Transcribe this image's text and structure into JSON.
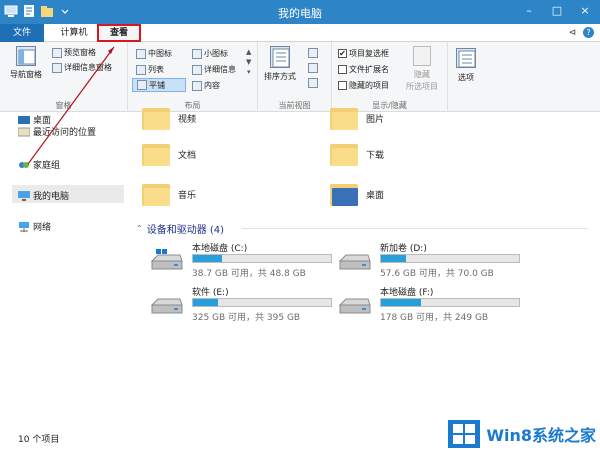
{
  "window": {
    "title": "我的电脑",
    "controls": [
      "–",
      "□",
      "×"
    ]
  },
  "tabs": {
    "file": "文件",
    "computer": "计算机",
    "view": "查看"
  },
  "ribbon": {
    "pane_group": {
      "nav_pane": "导航窗格",
      "preview_pane": "预览窗格",
      "details_pane": "详细信息窗格",
      "label": "窗格"
    },
    "layout_group": {
      "medium_icons": "中图标",
      "small_icons": "小图标",
      "list": "列表",
      "details": "详细信息",
      "tiles": "平铺",
      "content": "内容",
      "label": "布局"
    },
    "view_group": {
      "sort_by": "排序方式",
      "label": "当前视图"
    },
    "show_group": {
      "item_checkboxes": "项目复选框",
      "item_checkboxes_checked": "✔",
      "file_extensions": "文件扩展名",
      "hidden_items": "隐藏的项目",
      "hide_selected_1": "隐藏",
      "hide_selected_2": "所选项目",
      "label": "显示/隐藏"
    },
    "options": "选项"
  },
  "nav": {
    "desktop": "桌面",
    "recent": "最近访问的位置",
    "homegroup": "家庭组",
    "this_pc": "我的电脑",
    "network": "网络"
  },
  "folders": {
    "videos": "视频",
    "pictures": "图片",
    "documents": "文档",
    "downloads": "下载",
    "music": "音乐",
    "desktop": "桌面"
  },
  "devices_section": "设备和驱动器 (4)",
  "drives": [
    {
      "name": "本地磁盘 (C:)",
      "space": "38.7 GB 可用，共 48.8 GB",
      "used_fraction": 0.21
    },
    {
      "name": "新加卷 (D:)",
      "space": "57.6 GB 可用，共 70.0 GB",
      "used_fraction": 0.18
    },
    {
      "name": "软件 (E:)",
      "space": "325 GB 可用，共 395 GB",
      "used_fraction": 0.18
    },
    {
      "name": "本地磁盘 (F:)",
      "space": "178 GB 可用，共 249 GB",
      "used_fraction": 0.29
    }
  ],
  "status": {
    "item_count": "10 个项目"
  },
  "watermark": {
    "text": "Win8系统之家"
  },
  "colors": {
    "titlebar": "#2d84c6",
    "accent": "#1f6fb5",
    "highlight": "#d8181e",
    "drive_fill": "#26a0da"
  }
}
